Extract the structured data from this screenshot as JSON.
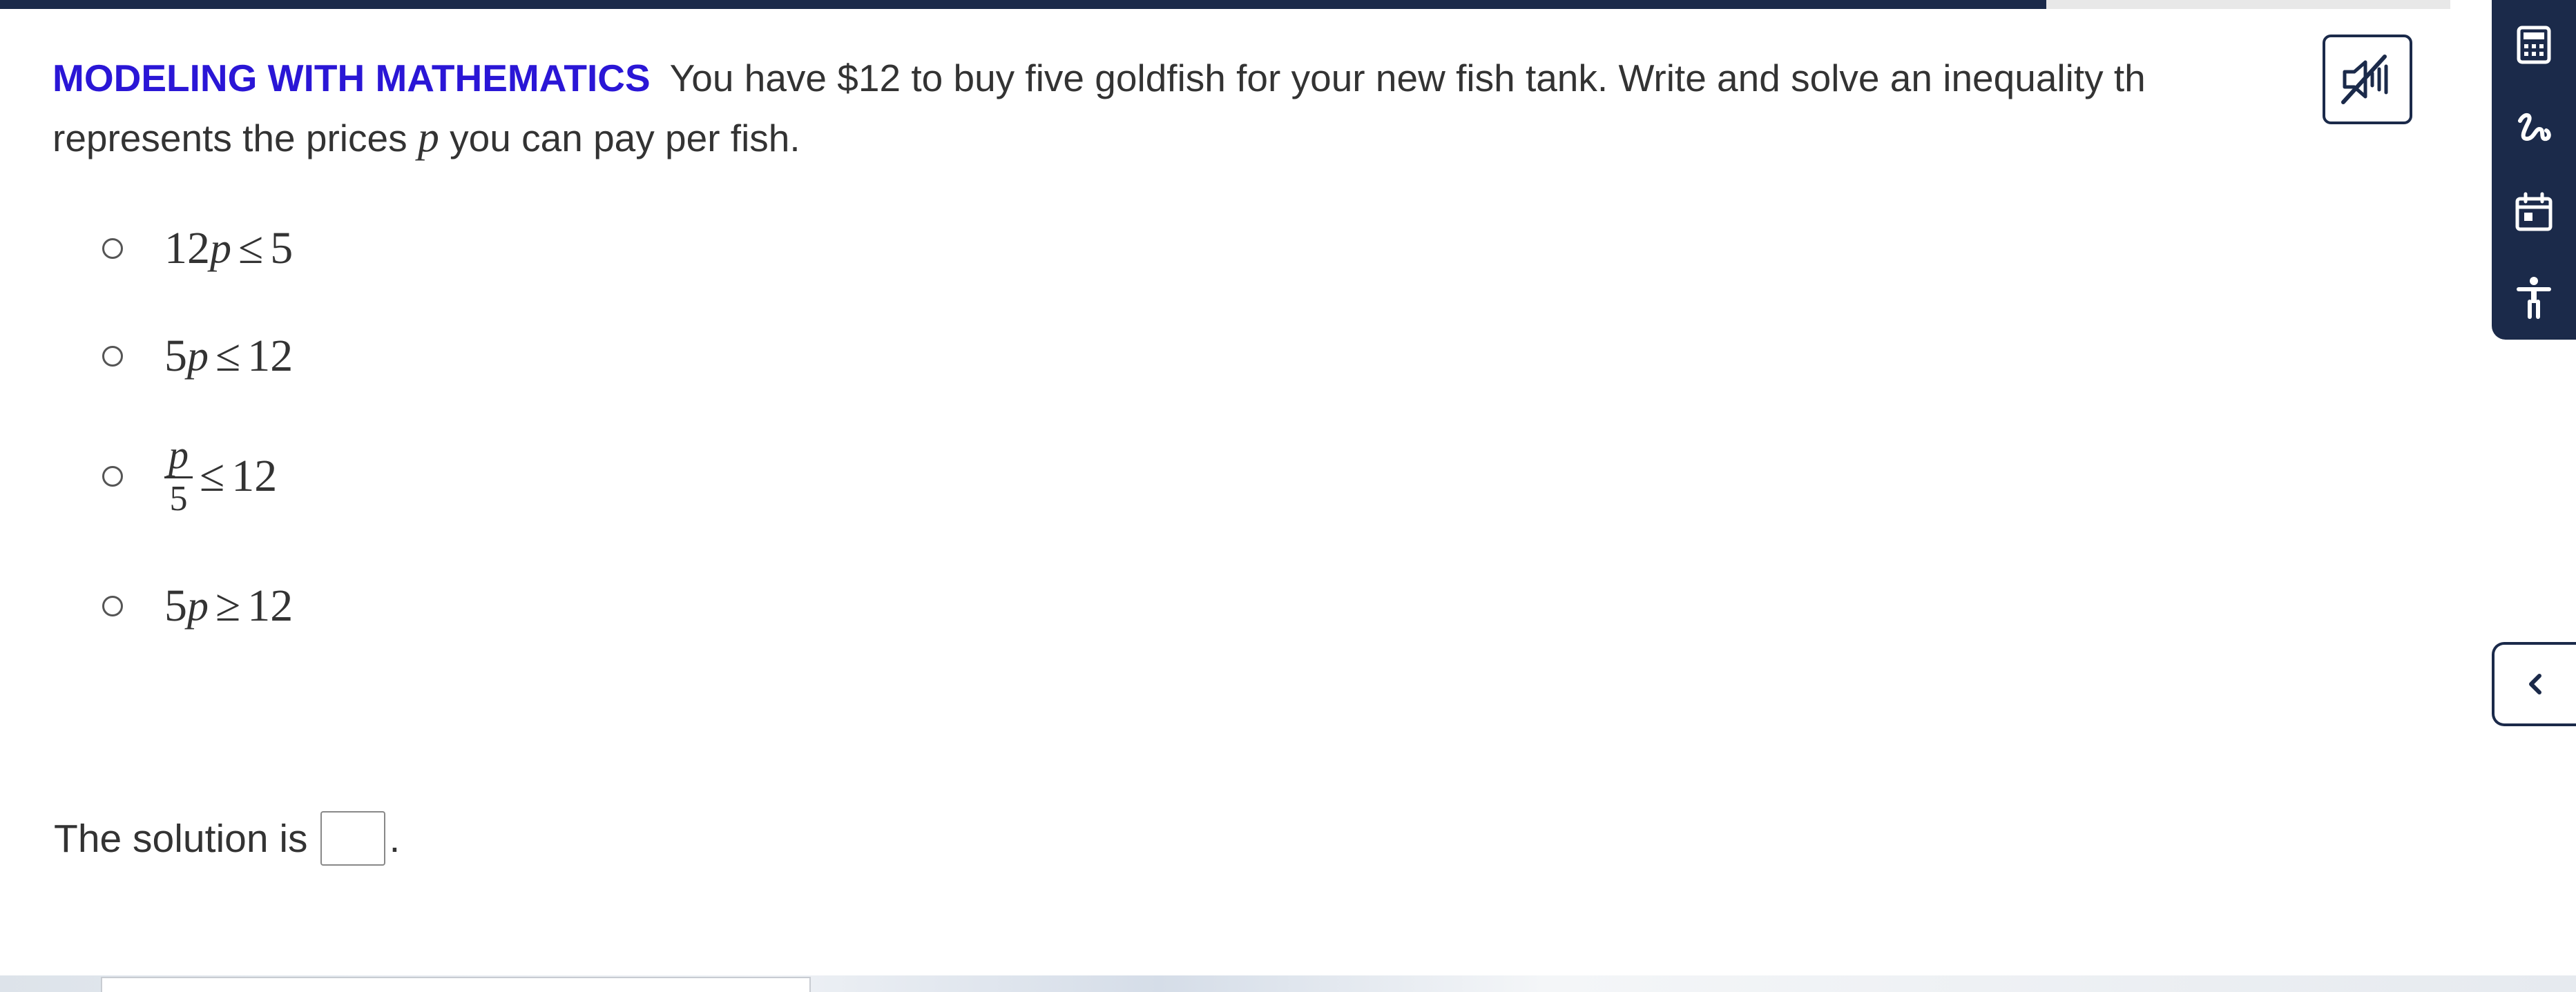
{
  "progress": {
    "fraction": 0.835
  },
  "question": {
    "label": "MODELING WITH MATHEMATICS",
    "text_part1": "You have $12 to buy five goldfish for your new fish tank. Write and solve an inequality th",
    "text_part2": "represents the prices ",
    "variable": "p",
    "text_part3": " you can pay per fish."
  },
  "audio_button": {
    "icon": "speaker-muted-icon"
  },
  "options": [
    {
      "lhs": "12",
      "var": "p",
      "op": "≤",
      "rhs": "5"
    },
    {
      "lhs": "5",
      "var": "p",
      "op": "≤",
      "rhs": "12"
    },
    {
      "frac_num": "p",
      "frac_den": "5",
      "op": "≤",
      "rhs": "12"
    },
    {
      "lhs": "5",
      "var": "p",
      "op": "≥",
      "rhs": "12"
    }
  ],
  "solution": {
    "label": "The solution is",
    "value": "",
    "period": "."
  },
  "toolbar": {
    "icons": [
      "calculator-icon",
      "scribble-icon",
      "calendar-icon",
      "accessibility-icon"
    ]
  },
  "collapse": {
    "icon": "chevron-left-icon"
  },
  "colors": {
    "navy": "#1b2a4a",
    "label_blue": "#2a16d6"
  }
}
